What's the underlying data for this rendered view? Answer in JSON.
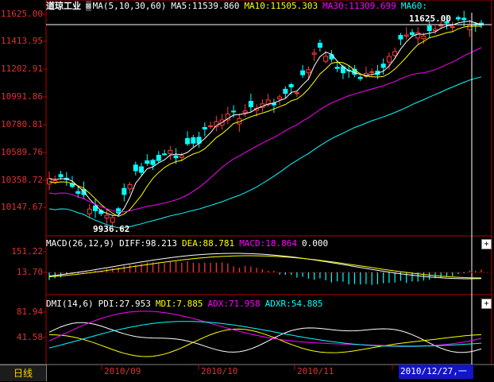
{
  "main_chart": {
    "title": "道琼工业",
    "indicator_name": "MA(5,10,30,60)",
    "ma5": "MA5:11539.860",
    "ma10": "MA10:11505.303",
    "ma30": "MA30:11309.699",
    "ma60": "MA60:",
    "price_labels": [
      "11625.00",
      "11413.95",
      "11202.91",
      "10991.86",
      "10780.81",
      "10589.76",
      "10358.72",
      "10147.67"
    ],
    "high_label": "11625.00",
    "low_label": "9936.62"
  },
  "macd": {
    "name": "MACD(26,12,9)",
    "diff": "DIFF:98.213",
    "dea": "DEA:88.781",
    "macd": "MACD:18.864",
    "extra": "0.000",
    "labels": [
      "151.22",
      "13.70"
    ]
  },
  "dmi": {
    "name": "DMI(14,6)",
    "pdi": "PDI:27.953",
    "mdi": "MDI:7.885",
    "adx": "ADX:71.958",
    "adxr": "ADXR:54.885",
    "labels": [
      "81.94",
      "41.58"
    ]
  },
  "footer": {
    "period": "日线",
    "months": [
      "2010/09",
      "2010/10",
      "2010/11"
    ],
    "cursor_date": "2010/12/27,一"
  },
  "buttons": {
    "expand": "+"
  },
  "colors": {
    "up": "#ff3c3c",
    "down": "#00ffff",
    "ma5": "#ffffff",
    "ma10": "#ffff00",
    "ma30": "#ff00ff",
    "ma60": "#00ffff",
    "axis": "#b40000",
    "label": "#e03030"
  }
}
